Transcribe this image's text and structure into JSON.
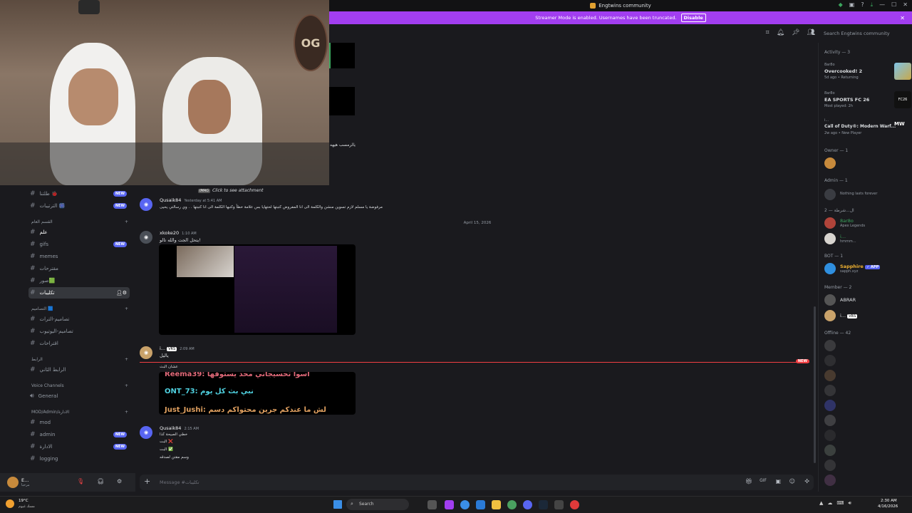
{
  "window": {
    "title": "Engtwins community"
  },
  "banner": {
    "text": "Streamer Mode is enabled. Usernames have been truncated.",
    "disable": "Disable"
  },
  "search": {
    "placeholder": "Search Engtwins community"
  },
  "webcam": {
    "logo": "OG"
  },
  "sidebar": {
    "channels": [
      {
        "label": "طلتنا 🐞",
        "badge": "NEW"
      },
      {
        "label": "الترتيبات 🎆",
        "badge": "NEW"
      },
      {
        "label": "علم",
        "badge": ""
      },
      {
        "label": "gifs",
        "badge": "NEW"
      },
      {
        "label": "memes",
        "badge": ""
      },
      {
        "label": "مقترحات",
        "badge": ""
      },
      {
        "label": "صور🟩",
        "badge": ""
      },
      {
        "label": "تكليبات",
        "badge": ""
      },
      {
        "label": "تصاميم-الترات",
        "badge": ""
      },
      {
        "label": "تصاميم-اليوتيوب",
        "badge": ""
      },
      {
        "label": "اقتراحات",
        "badge": ""
      },
      {
        "label": "الرابط الثاني",
        "badge": ""
      },
      {
        "label": "General",
        "badge": ""
      },
      {
        "label": "mod",
        "badge": ""
      },
      {
        "label": "admin",
        "badge": "NEW"
      },
      {
        "label": "الادارة",
        "badge": "NEW"
      },
      {
        "label": "logging",
        "badge": ""
      }
    ],
    "categories": [
      "القسم العام",
      "التصاميم 🟦",
      "الرابط",
      "Voice Channels",
      "MOD/Admin/الادارة"
    ],
    "user": {
      "name": "E...",
      "status": "مرحبا"
    }
  },
  "chat": {
    "reply_line": "Click to see attachment",
    "messages": [
      {
        "user": "Qusaik84",
        "time": "Yesterday at 5:41 AM",
        "text": "مرفوضة يا مسلم لازم تسوين منشن والكلمة الى انا المفروض كتبتها لحتهايا بس علامة خطأ وكتبها الكلمة الى انا كتبتها . . وي رسالتي يحيى"
      },
      {
        "user": "xkoke20",
        "time": "1:10 AM",
        "text": "يتحل الجت والله تالو!"
      },
      {
        "user": "i...",
        "time": "2:09 AM",
        "text": "ياليل",
        "tag": "VRS"
      },
      {
        "user": "Qusaik84",
        "time": "2:15 AM",
        "text": "خطي الصيحة كذا",
        "lines": [
          "البت ❌",
          "البت ✅",
          "وسم مقتن لصدقه"
        ]
      }
    ],
    "date_divider": "April 15, 2026",
    "new_label": "NEW",
    "embed_lines": [
      "Reema39: اسوا تحسيجاني محد يستوفها",
      "ONT_73: نبي بث كل يوم",
      "Just_Jushi: لش ما عندكم جرين محتواكم دسم"
    ],
    "mention_line": "عشان البث",
    "composer_placeholder": "Message #تكليبات"
  },
  "members": {
    "activity_header": "Activity — 3",
    "activities": [
      {
        "name": "8ar8o",
        "game": "Overcooked! 2",
        "sub": "5d ago • Returning"
      },
      {
        "name": "8ar8o",
        "game": "EA SPORTS FC 26",
        "sub": "Most played: 2h"
      },
      {
        "name": "i...",
        "game": "Call of Duty®: Modern Warf...",
        "sub": "2w ago • New Player"
      }
    ],
    "owner_header": "Owner — 1",
    "admin_header": "Admin — 1",
    "admin_status": "Nothing lasts forever",
    "third_header": "ال...شرطة — 2",
    "third_members": [
      {
        "name": "8ar8o",
        "sub": "Apex Legends"
      },
      {
        "name": "i...",
        "sub": "hmmm..."
      }
    ],
    "bot_header": "BOT — 1",
    "bot": {
      "name": "Sapphire",
      "tag": "✓ APP",
      "sub": "sapph.xyz"
    },
    "member_header": "Member — 2",
    "member_list": [
      {
        "name": "ABRAR"
      },
      {
        "name": "i...",
        "tag": "VRS"
      }
    ],
    "offline_header": "Offline — 42"
  },
  "taskbar": {
    "weather_temp": "19°C",
    "weather_desc": "مسك غيوم",
    "search": "Search",
    "time": "2:30 AM",
    "date": "4/16/2026"
  }
}
